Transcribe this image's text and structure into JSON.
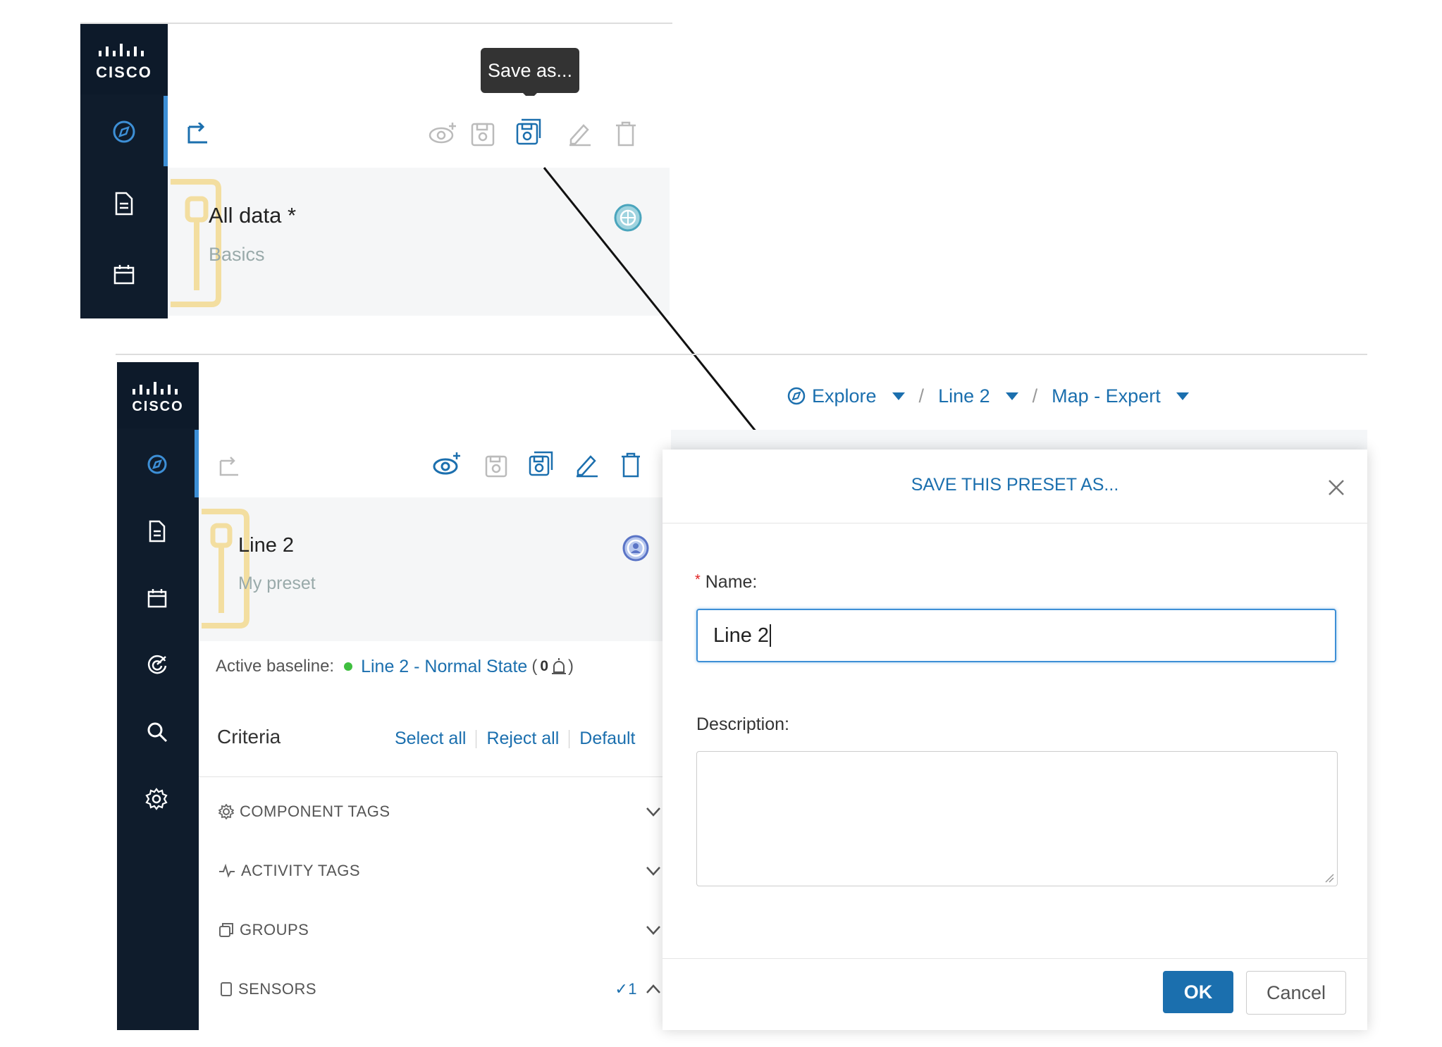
{
  "brand": {
    "logo_text": "CISCO"
  },
  "top": {
    "tooltip": "Save as...",
    "preset_title": "All data *",
    "preset_subtitle": "Basics"
  },
  "bottom": {
    "breadcrumb": [
      {
        "label": "Explore"
      },
      {
        "label": "Line 2"
      },
      {
        "label": "Map - Expert"
      }
    ],
    "preset_title": "Line 2",
    "preset_subtitle": "My preset",
    "active_baseline_label": "Active baseline:",
    "active_baseline_value": "Line 2 - Normal State",
    "active_baseline_count_open": "(",
    "active_baseline_count": "0",
    "active_baseline_count_close": ")",
    "criteria": {
      "title": "Criteria",
      "select_all": "Select all",
      "reject_all": "Reject all",
      "default": "Default"
    },
    "sections": [
      {
        "label": "COMPONENT TAGS"
      },
      {
        "label": "ACTIVITY TAGS"
      },
      {
        "label": "GROUPS"
      },
      {
        "label": "SENSORS",
        "badge": "✓1"
      }
    ]
  },
  "modal": {
    "title": "SAVE THIS PRESET AS...",
    "required_mark": "*",
    "name_label": "Name:",
    "name_value": "Line 2",
    "description_label": "Description:",
    "description_value": "",
    "ok_label": "OK",
    "cancel_label": "Cancel"
  },
  "colors": {
    "accent": "#1b6fae",
    "sidebar": "#0f1c2c",
    "selected": "#3d8fd6"
  }
}
